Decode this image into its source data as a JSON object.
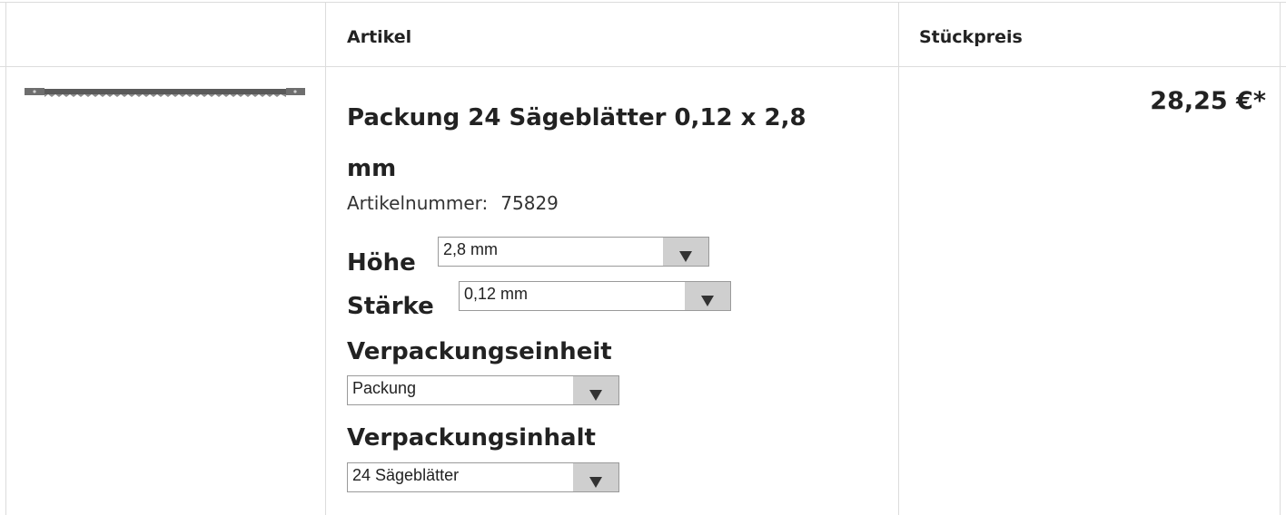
{
  "table": {
    "headers": {
      "article": "Artikel",
      "unit_price": "Stückpreis"
    }
  },
  "product": {
    "image_icon": "saw-blade-image",
    "title": "Packung 24 Sägeblätter 0,12 x 2,8 mm",
    "article_number_label": "Artikelnummer:",
    "article_number": "75829",
    "options": [
      {
        "label": "Höhe",
        "value": "2,8 mm"
      },
      {
        "label": "Stärke",
        "value": "0,12 mm"
      },
      {
        "label": "Verpackungseinheit",
        "value": "Packung"
      },
      {
        "label": "Verpackungsinhalt",
        "value": "24 Sägeblätter"
      }
    ],
    "price": "28,25 €*"
  },
  "icons": {
    "dropdown": "triangle-down-icon"
  }
}
